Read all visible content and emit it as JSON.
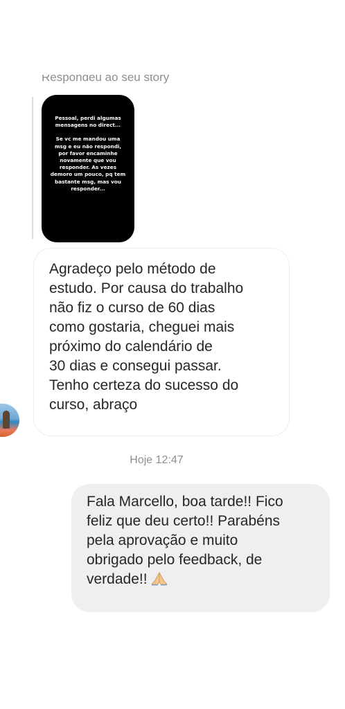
{
  "reply": {
    "header": "Respondeu ao seu story",
    "story_text_1": "Pessoal, perdi algumas mensagens no direct...",
    "story_text_2": "Se vc me mandou uma msg e eu não respondi, por favor encaminhe novamente que vou responder. As vezes demoro um pouco, pq tem bastante msg, mas vou responder..."
  },
  "messages": {
    "incoming_text": "Agradeço pelo método de\nestudo. Por causa do trabalho\nnão fiz o curso de 60 dias\ncomo gostaria, cheguei mais\npróximo do calendário de\n30 dias e consegui passar.\nTenho certeza do sucesso do\ncurso, abraço",
    "timestamp": "Hoje 12:47",
    "outgoing_text": "Fala Marcello, boa tarde!! Fico\nfeliz que deu certo!! Parabéns\npela aprovação e muito\nobrigado pelo feedback, de\nverdade!!",
    "outgoing_emoji": "folded-hands-icon"
  },
  "colors": {
    "outgoing_bubble": "#efefef",
    "incoming_border": "#ececec",
    "meta_text": "#8e8e8e",
    "story_background": "#000000"
  }
}
